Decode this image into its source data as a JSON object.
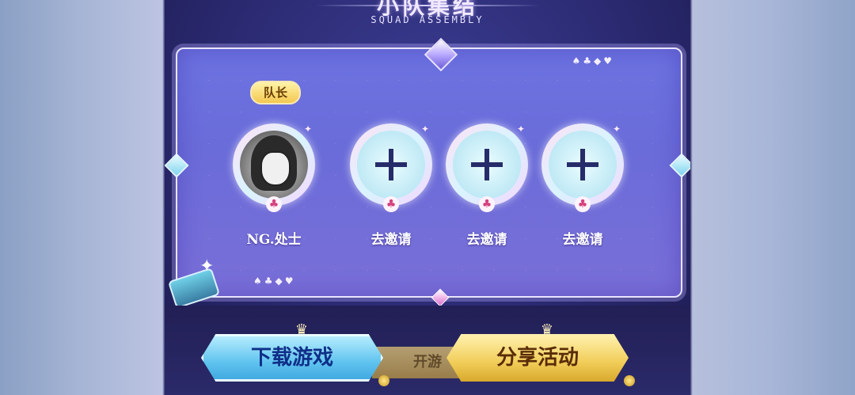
{
  "header": {
    "title": "小队集结",
    "subtitle": "SQUAD ASSEMBLY"
  },
  "panel": {
    "suits": "♠♣◆♥",
    "leader_badge": "队长",
    "members": [
      {
        "label": "NG.处士",
        "type": "avatar"
      },
      {
        "label": "去邀请",
        "type": "invite"
      },
      {
        "label": "去邀请",
        "type": "invite"
      },
      {
        "label": "去邀请",
        "type": "invite"
      }
    ]
  },
  "buttons": {
    "download": "下载游戏",
    "hidden_behind": "开游",
    "share": "分享活动"
  },
  "colors": {
    "panel": "#6a6cd9",
    "download_btn": "#5fc3ef",
    "share_btn": "#f1cd58",
    "plus": "#262c6a"
  }
}
